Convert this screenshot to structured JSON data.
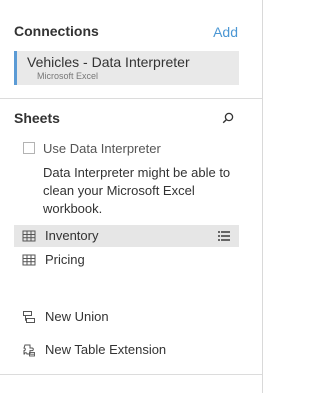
{
  "connections": {
    "title": "Connections",
    "add_label": "Add",
    "items": [
      {
        "name": "Vehicles - Data Interpreter",
        "type": "Microsoft Excel"
      }
    ]
  },
  "sheets": {
    "title": "Sheets",
    "use_interpreter_label": "Use Data Interpreter",
    "use_interpreter_checked": false,
    "interpreter_description": "Data Interpreter might be able to clean your Microsoft Excel workbook.",
    "items": [
      {
        "label": "Inventory",
        "icon": "table-icon",
        "selected": true
      },
      {
        "label": "Pricing",
        "icon": "table-icon",
        "selected": false
      }
    ],
    "actions": [
      {
        "label": "New Union",
        "icon": "union-icon"
      },
      {
        "label": "New Table Extension",
        "icon": "table-extension-icon"
      }
    ]
  },
  "colors": {
    "accent": "#4b97d4",
    "selection": "#e6e6e6",
    "connection_bar": "#5b9bd5"
  }
}
